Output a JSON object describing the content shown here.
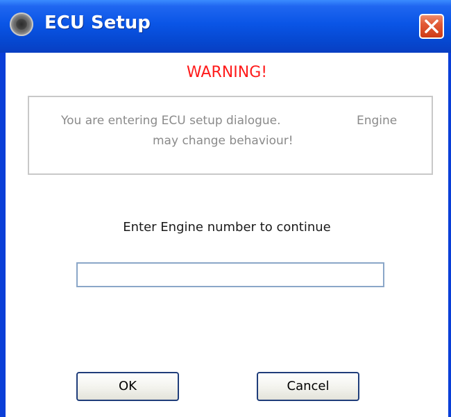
{
  "window": {
    "title": "ECU Setup",
    "icon": "gear-wheel-icon",
    "close_icon": "close-icon"
  },
  "dialog": {
    "warning_title": "WARNING!",
    "message_line1": "You are entering ECU setup dialogue.",
    "message_engine_word": "Engine",
    "message_line2": "may change behaviour!",
    "prompt": "Enter Engine number to continue",
    "engine_number_value": "",
    "engine_number_placeholder": ""
  },
  "buttons": {
    "ok_label": "OK",
    "cancel_label": "Cancel"
  },
  "colors": {
    "titlebar": "#0a55e6",
    "warning": "#ff1a1a",
    "close_button": "#e25a36"
  }
}
